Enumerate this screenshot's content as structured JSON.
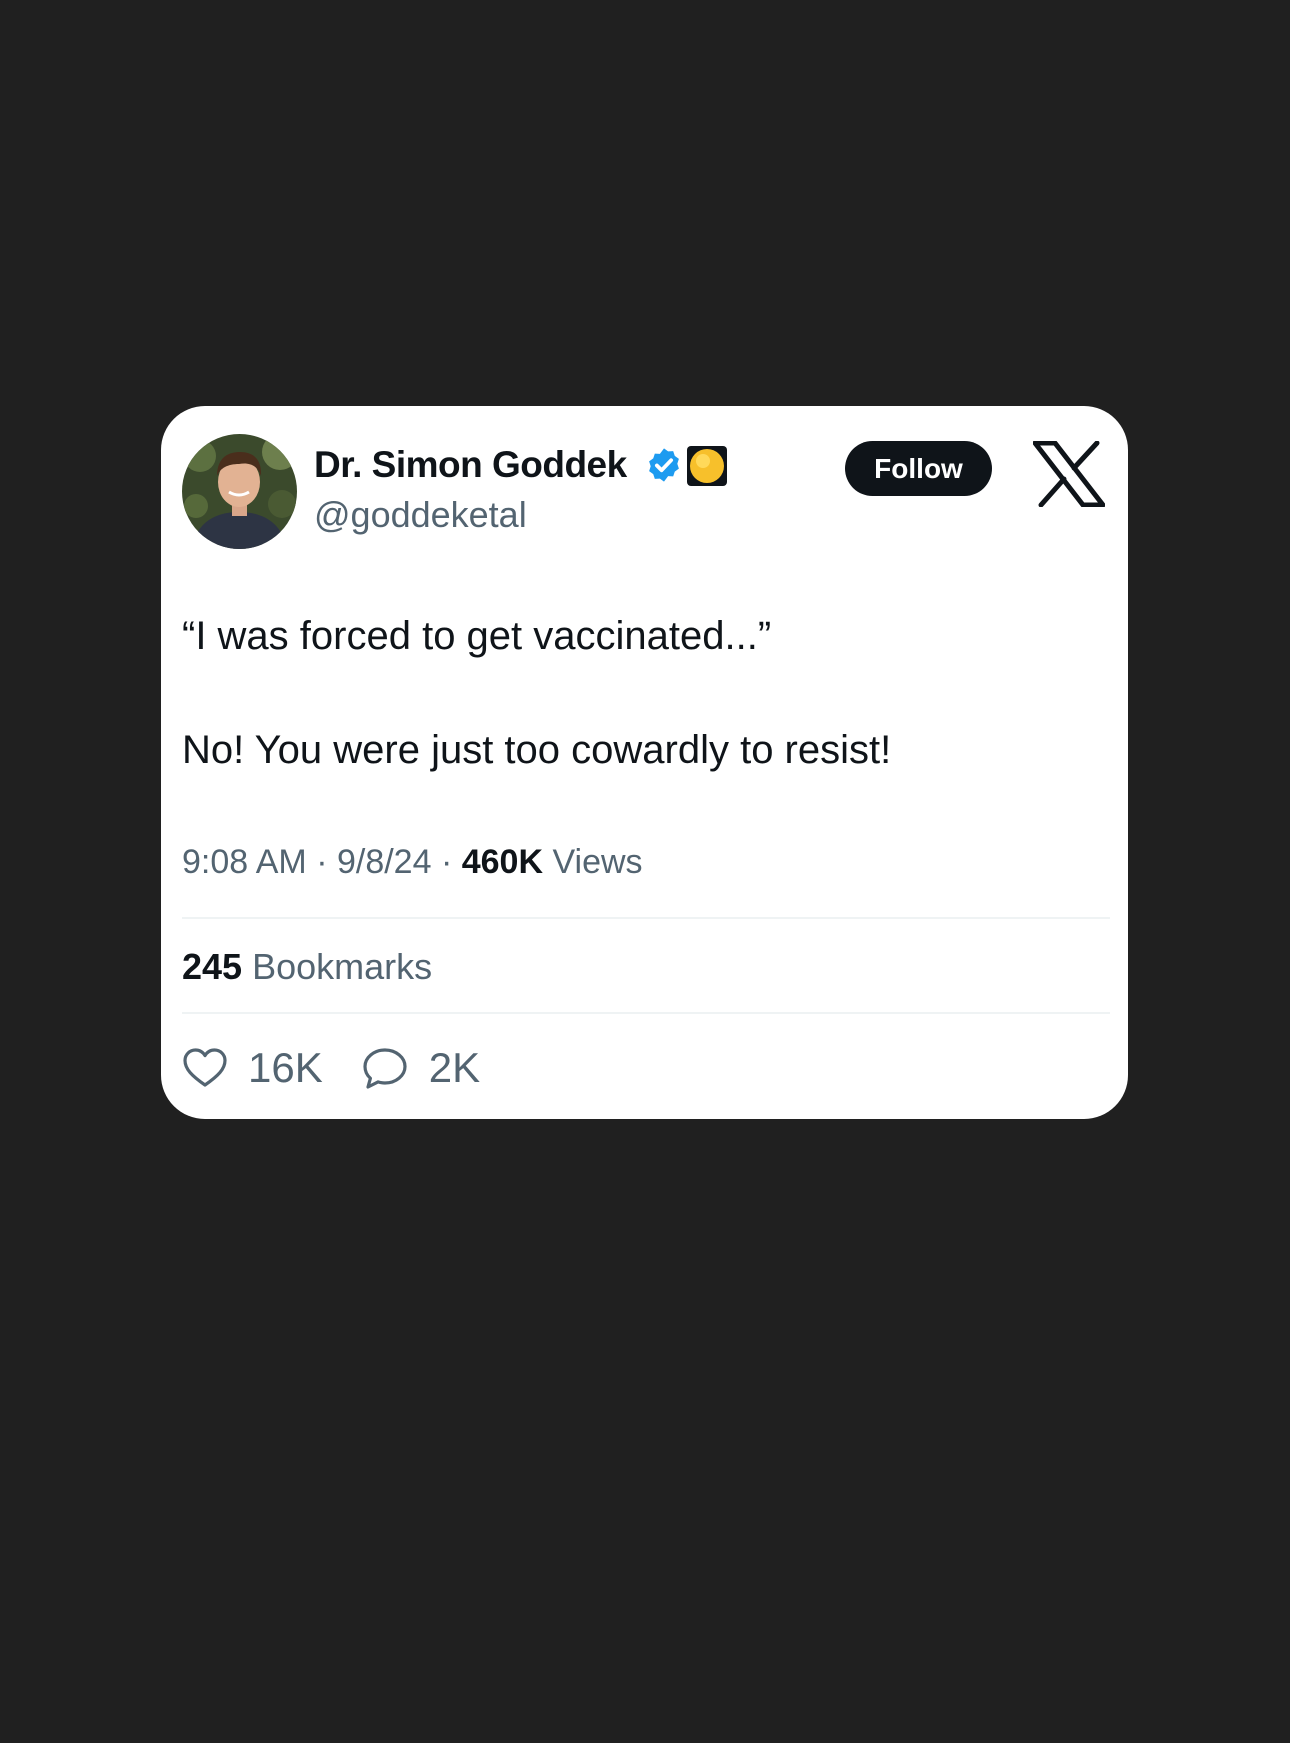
{
  "author": {
    "display_name": "Dr. Simon Goddek",
    "handle": "@goddeketal",
    "follow_label": "Follow"
  },
  "tweet": {
    "line1": "“I was forced to get vaccinated...”",
    "line2": "No! You were just too cowardly to resist!"
  },
  "meta": {
    "time": "9:08 AM",
    "sep1": " · ",
    "date": "9/8/24",
    "sep2": " · ",
    "views_count": "460K",
    "views_label": " Views"
  },
  "bookmarks": {
    "count": "245",
    "label": " Bookmarks"
  },
  "actions": {
    "likes": "16K",
    "replies": "2K"
  },
  "icons": {
    "verified": "verified-badge-icon",
    "org_badge": "gold-circle-badge-icon",
    "logo": "x-logo-icon",
    "like": "heart-icon",
    "reply": "speech-bubble-icon"
  },
  "colors": {
    "background": "#202020",
    "card": "#ffffff",
    "text_primary": "#0f1419",
    "text_secondary": "#536471",
    "verified": "#1d9bf0",
    "gold_badge": "#f7c02b",
    "divider": "#eff3f4"
  }
}
